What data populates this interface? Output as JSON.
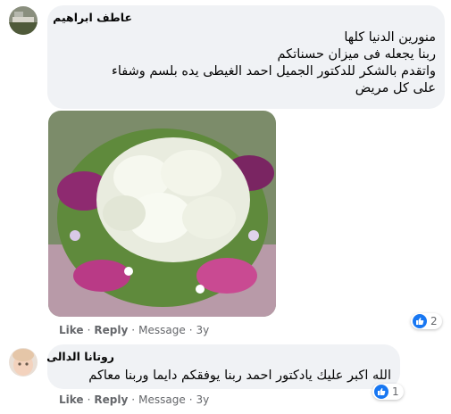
{
  "comments": [
    {
      "author": "عاطف ابراهيم",
      "lines": [
        "منورين الدنيا كلها",
        "ربنا يجعله فى ميزان حسناتكم",
        "واتقدم بالشكر للدكتور الجميل احمد الغيطى يده بلسم وشفاء",
        "على كل مريض"
      ],
      "actions": {
        "like": "Like",
        "reply": "Reply",
        "message": "Message",
        "time": "3y"
      },
      "reaction_count": "2"
    },
    {
      "author": "روتانا الدالى",
      "lines": [
        "الله اكبر عليك يادكتور احمد ربنا يوفقكم دايما وربنا معاكم"
      ],
      "actions": {
        "like": "Like",
        "reply": "Reply",
        "message": "Message",
        "time": "3y"
      },
      "reaction_count": "1"
    }
  ],
  "colors": {
    "bubble": "#f0f2f5",
    "like_blue": "#1877f2",
    "meta_gray": "#65676b"
  },
  "icons": {
    "reaction": "thumbs-up-icon"
  }
}
